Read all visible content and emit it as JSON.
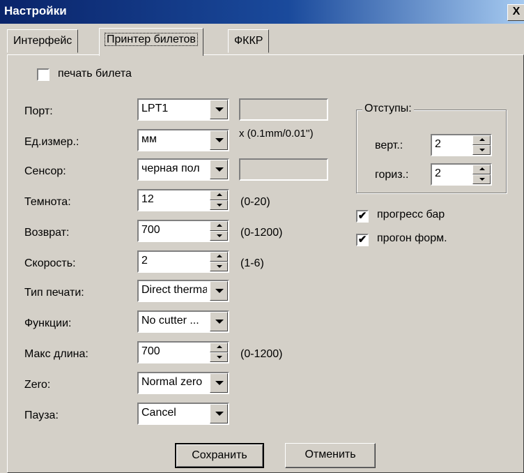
{
  "window": {
    "title": "Настройки",
    "close": "X"
  },
  "tabs": [
    {
      "label": "Интерфейс"
    },
    {
      "label": "Принтер билетов"
    },
    {
      "label": "ФККР"
    }
  ],
  "print_ticket": {
    "label": "печать билета",
    "checked": false
  },
  "fields": {
    "port": {
      "label": "Порт:",
      "value": "LPT1"
    },
    "units": {
      "label": "Ед.измер.:",
      "value": "мм",
      "hint": "x (0.1mm/0.01'')"
    },
    "sensor": {
      "label": "Сенсор:",
      "value": "черная пол"
    },
    "darkness": {
      "label": "Темнота:",
      "value": "12",
      "range": "(0-20)"
    },
    "return": {
      "label": "Возврат:",
      "value": "700",
      "range": "(0-1200)"
    },
    "speed": {
      "label": "Скорость:",
      "value": "2",
      "range": "(1-6)"
    },
    "print_type": {
      "label": "Тип печати:",
      "value": "Direct thermal"
    },
    "functions": {
      "label": "Функции:",
      "value": "No cutter ..."
    },
    "max_length": {
      "label": "Макс длина:",
      "value": "700",
      "range": "(0-1200)"
    },
    "zero": {
      "label": "Zero:",
      "value": "Normal zero"
    },
    "pause": {
      "label": "Пауза:",
      "value": "Cancel"
    }
  },
  "offsets": {
    "title": "Отступы:",
    "vert": {
      "label": "верт.:",
      "value": "2"
    },
    "horiz": {
      "label": "гориз.:",
      "value": "2"
    }
  },
  "progress_bar": {
    "label": "прогресс бар",
    "checked": true,
    "mark": "✔"
  },
  "form_feed": {
    "label": "прогон форм.",
    "checked": true,
    "mark": "✔"
  },
  "buttons": {
    "save": "Сохранить",
    "cancel": "Отменить"
  },
  "colors": {
    "titlebar": "#0a246a",
    "face": "#d4d0c8"
  }
}
